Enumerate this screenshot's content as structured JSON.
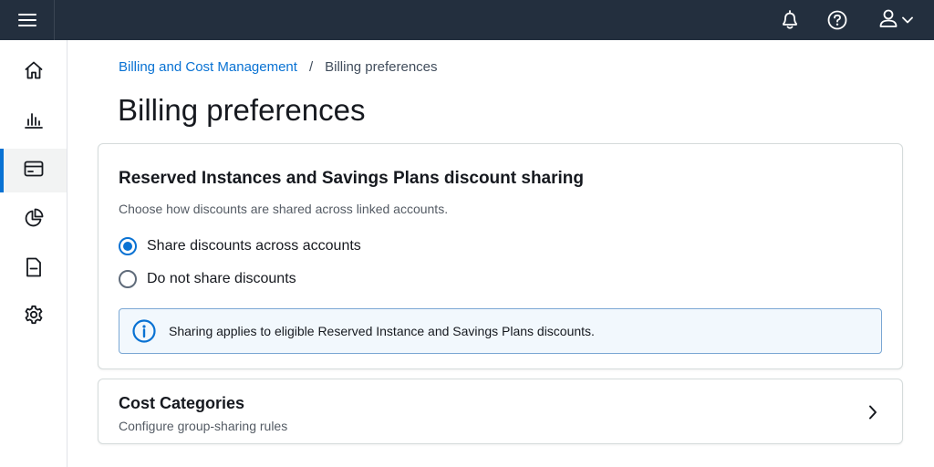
{
  "topbar": {
    "menu_icon": "hamburger-menu-icon",
    "notifications_icon": "bell-icon",
    "help_icon": "help-circle-icon",
    "user_icon": "user-icon",
    "user_chevron_icon": "chevron-down-icon"
  },
  "sidenav": {
    "items": [
      {
        "icon": "home-icon",
        "active": false
      },
      {
        "icon": "bar-chart-icon",
        "active": false
      },
      {
        "icon": "credit-card-icon",
        "active": true
      },
      {
        "icon": "pie-chart-icon",
        "active": false
      },
      {
        "icon": "document-icon",
        "active": false
      },
      {
        "icon": "gear-icon",
        "active": false
      }
    ],
    "accent_color": "#0972d3"
  },
  "breadcrumb": {
    "parent": "Billing and Cost Management",
    "separator": "/",
    "current": "Billing preferences"
  },
  "page": {
    "title": "Billing preferences"
  },
  "discount_sharing": {
    "title": "Reserved Instances and Savings Plans discount sharing",
    "description": "Choose how discounts are shared across linked accounts.",
    "options": [
      {
        "label": "Share discounts across accounts",
        "selected": true
      },
      {
        "label": "Do not share discounts",
        "selected": false
      }
    ],
    "info": {
      "icon": "info-icon",
      "text": "Sharing applies to eligible Reserved Instance and Savings Plans discounts."
    }
  },
  "cost_categories": {
    "title": "Cost Categories",
    "description": "Configure group-sharing rules",
    "icon": "chevron-right-icon"
  },
  "colors": {
    "topbar_bg": "#232f3e",
    "link": "#0972d3",
    "info_bg": "#f2f8fd",
    "info_border": "#7aa7d4"
  }
}
